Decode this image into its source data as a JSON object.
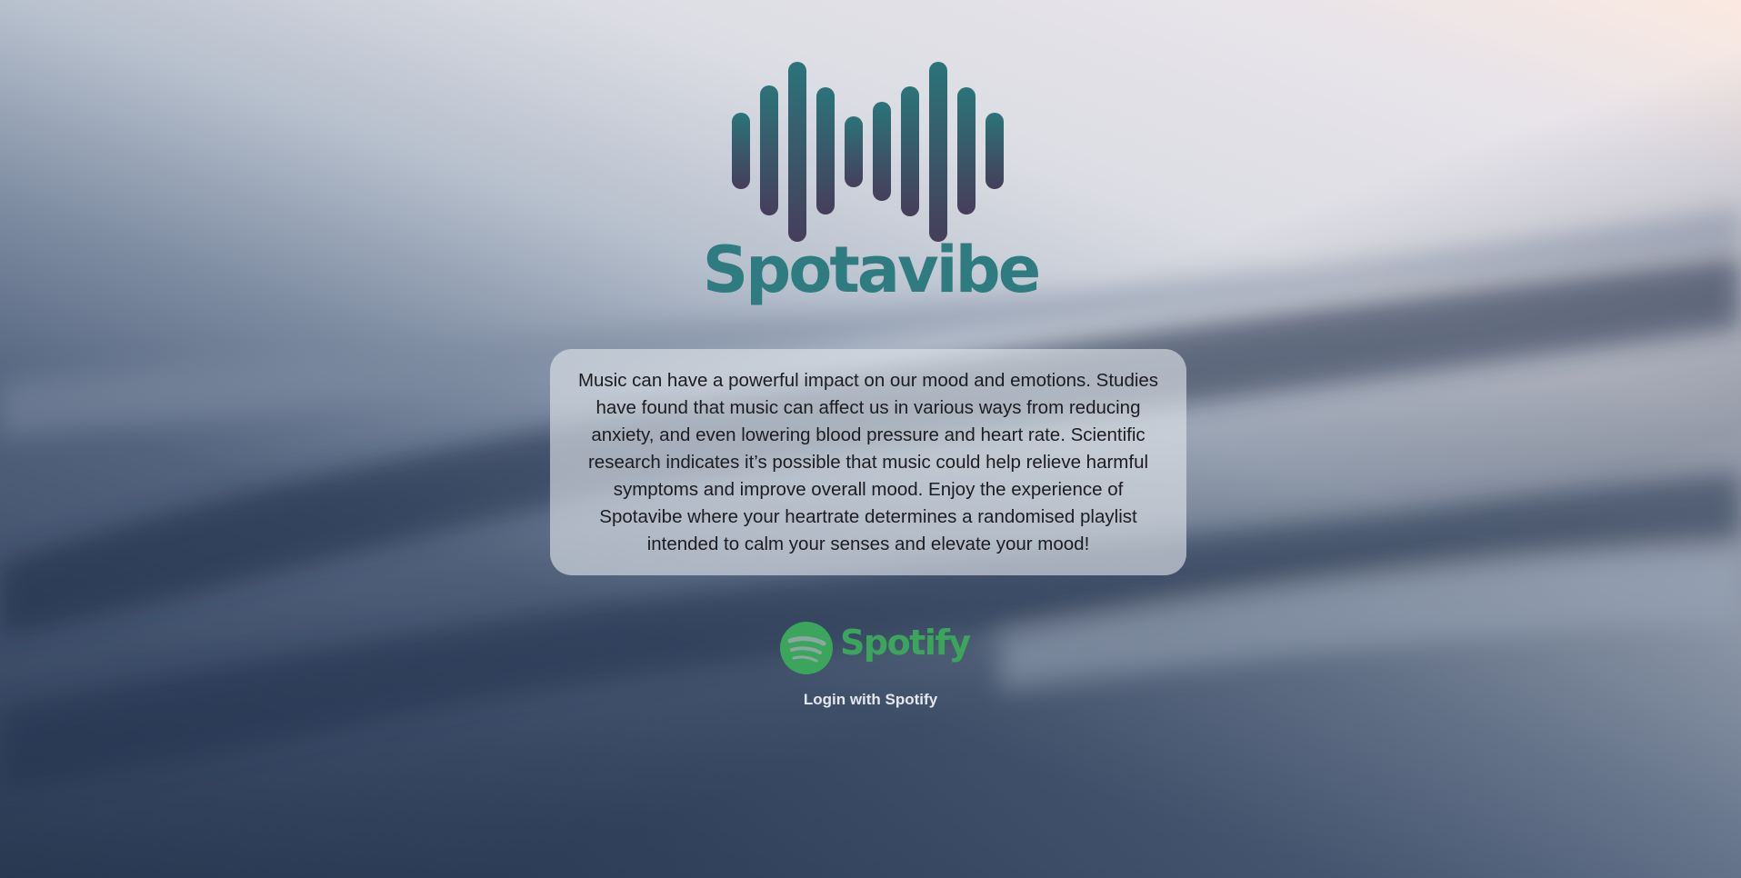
{
  "brand": {
    "name": "Spotavibe",
    "logo_icon": "sound-wave-bars",
    "text_color": "#2e7c7f",
    "bar_gradient": [
      "#2b7479",
      "#463e5a"
    ]
  },
  "intro": {
    "text": "Music can have a powerful impact on our mood and emotions. Studies have found that music can affect us in various ways from reducing anxiety, and even lowering blood pressure and heart rate. Scientific research indicates it’s possible that music could help relieve harmful symptoms and improve overall mood. Enjoy the experience of Spotavibe where your heartrate determines a randomised playlist intended to calm your senses and elevate your mood!"
  },
  "spotify": {
    "wordmark": "Spotify",
    "icon": "spotify-logo",
    "color": "#3ba55c",
    "login_label": "Login with Spotify"
  }
}
